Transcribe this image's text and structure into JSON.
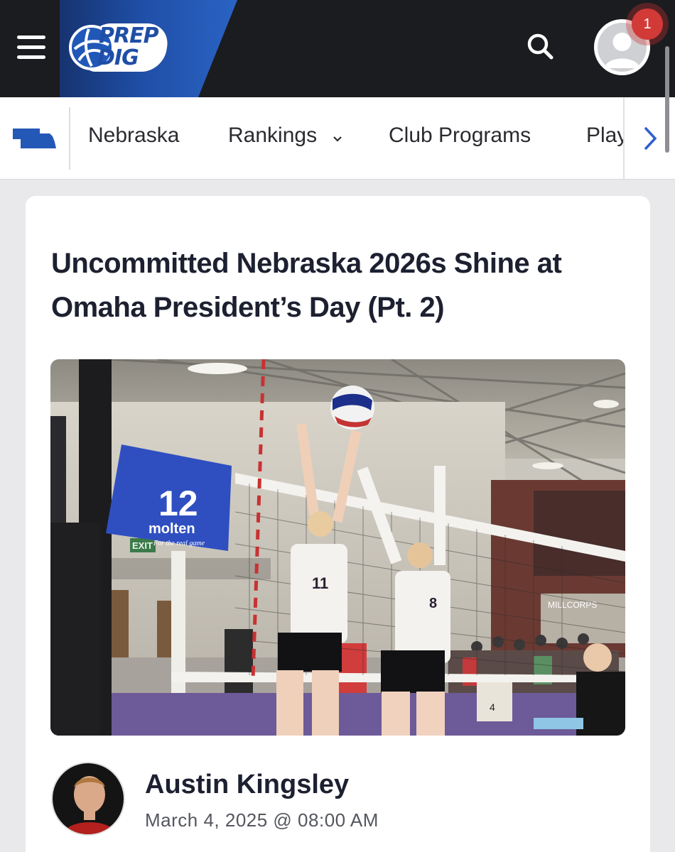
{
  "header": {
    "logo": {
      "line1": "PREP",
      "line2": "DIG"
    },
    "notification_count": "1",
    "icons": {
      "menu": "hamburger-menu-icon",
      "search": "search-icon",
      "profile": "user-avatar-icon"
    }
  },
  "nav": {
    "state_icon": "nebraska-state-icon",
    "items": [
      {
        "label": "Nebraska"
      },
      {
        "label": "Rankings",
        "dropdown": true
      },
      {
        "label": "Club Programs"
      },
      {
        "label": "Play"
      }
    ],
    "scroll_icon": "chevron-right-icon"
  },
  "article": {
    "title": "Uncommitted Nebraska 2026s Shine at Omaha President’s Day (Pt. 2)",
    "photo": {
      "flag_number": "12",
      "flag_brand": "molten",
      "flag_tagline": "For the real game",
      "exit_sign": "EXIT",
      "jersey_left": "11",
      "jersey_right": "8",
      "jersey_background": "4"
    },
    "author": {
      "name": "Austin Kingsley"
    },
    "date": "March 4, 2025 @ 08:00 AM"
  },
  "colors": {
    "topbar": "#1b1c1f",
    "brand_blue": "#1f4ea6",
    "badge_red": "#d23a37",
    "title_text": "#1d2030",
    "nav_chevron": "#2e5fd0"
  }
}
